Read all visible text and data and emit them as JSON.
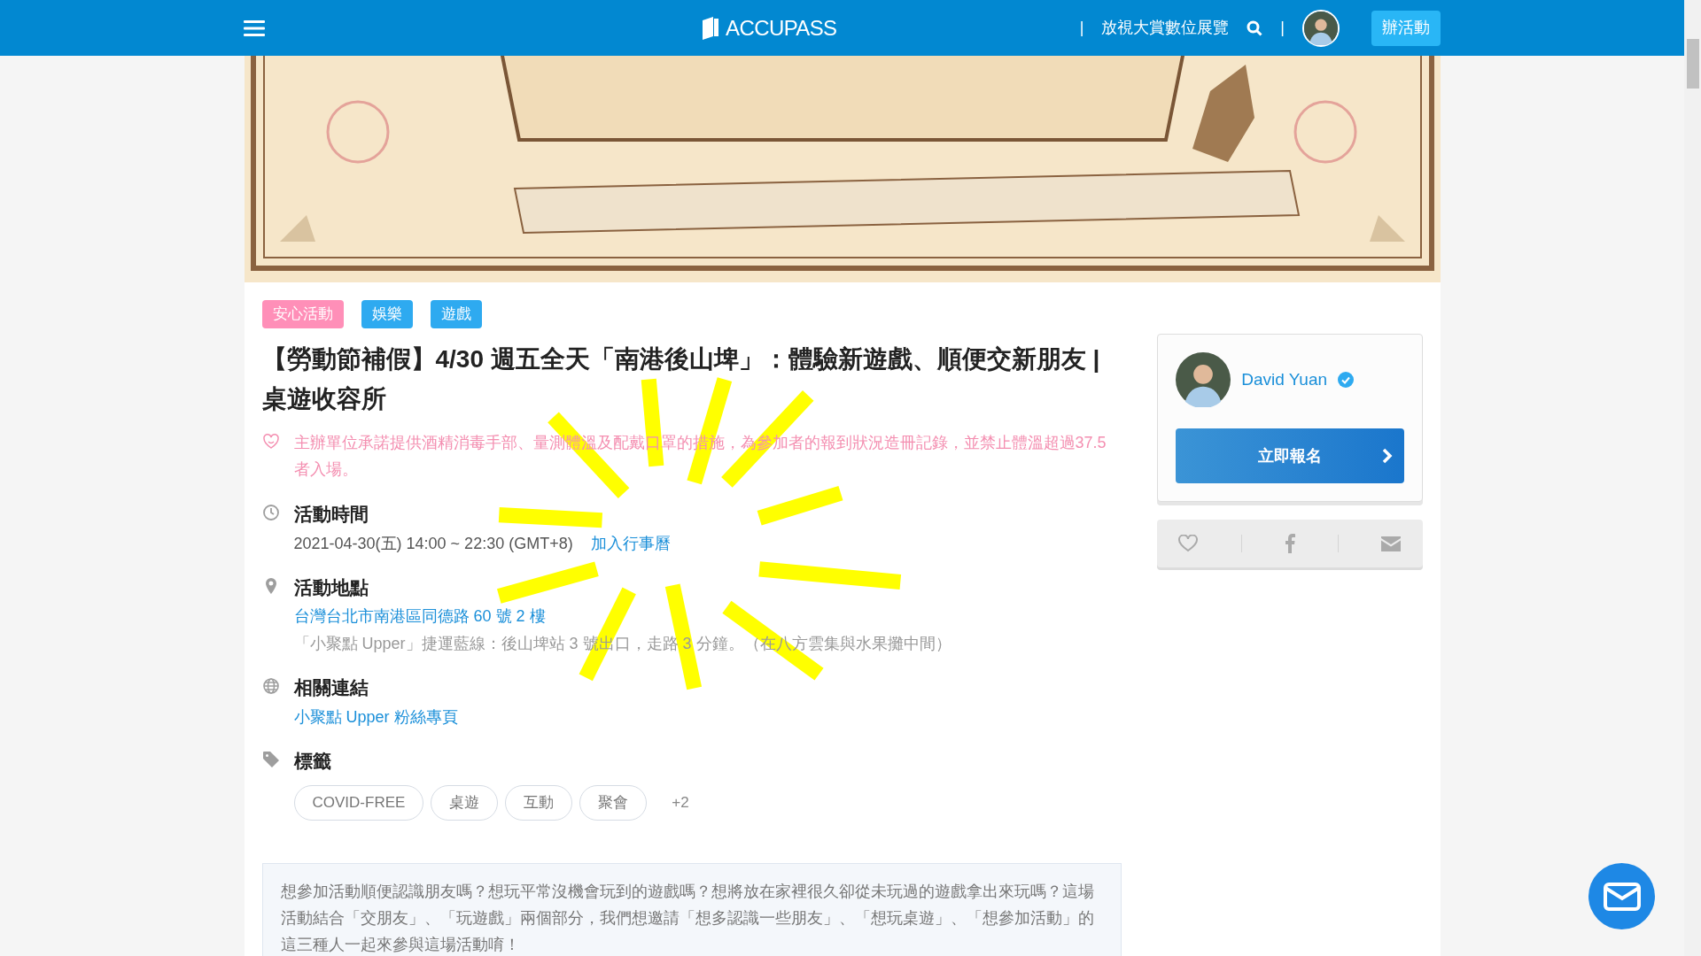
{
  "header": {
    "logo": "ACCUPASS",
    "separators": [
      "|",
      "|"
    ],
    "nav_link": "放視大賞數位展覽",
    "create_button": "辦活動"
  },
  "categories": [
    {
      "label": "安心活動",
      "color": "#ff8fb8"
    },
    {
      "label": "娛樂",
      "color": "#2eaaf0"
    },
    {
      "label": "遊戲",
      "color": "#2eaaf0"
    }
  ],
  "title": "【勞動節補假】4/30 週五全天「南港後山埤」：體驗新遊戲、順便交新朋友 | 桌遊收容所",
  "notice": "主辦單位承諾提供酒精消毒手部、量測體溫及配戴口罩的措施，為參加者的報到狀況造冊記錄，並禁止體溫超過37.5者入場。",
  "sections": [
    {
      "kind": "time",
      "heading": "活動時間",
      "text": "2021-04-30(五) 14:00 ~ 22:30 (GMT+8)",
      "link": "加入行事曆"
    },
    {
      "kind": "place",
      "heading": "活動地點",
      "link": "台灣台北市南港區同德路 60 號 2 樓",
      "note": "「小聚點 Upper」捷運藍線：後山埤站 3 號出口，走路 3 分鐘。（在八方雲集與水果攤中間）"
    },
    {
      "kind": "links",
      "heading": "相關連結",
      "link": "小聚點 Upper 粉絲專頁"
    },
    {
      "kind": "tags",
      "heading": "標籤",
      "tags": [
        "COVID-FREE",
        "桌遊",
        "互動",
        "聚會"
      ],
      "more": "+2"
    }
  ],
  "description": "想參加活動順便認識朋友嗎？想玩平常沒機會玩到的遊戲嗎？想將放在家裡很久卻從未玩過的遊戲拿出來玩嗎？這場活動結合「交朋友」、「玩遊戲」兩個部分，我們想邀請「想多認識一些朋友」、「想玩桌遊」、「想參加活動」的這三種人一起來參與這場活動唷！",
  "organizer": {
    "name": "David Yuan",
    "verified": true,
    "register_button": "立即報名"
  }
}
